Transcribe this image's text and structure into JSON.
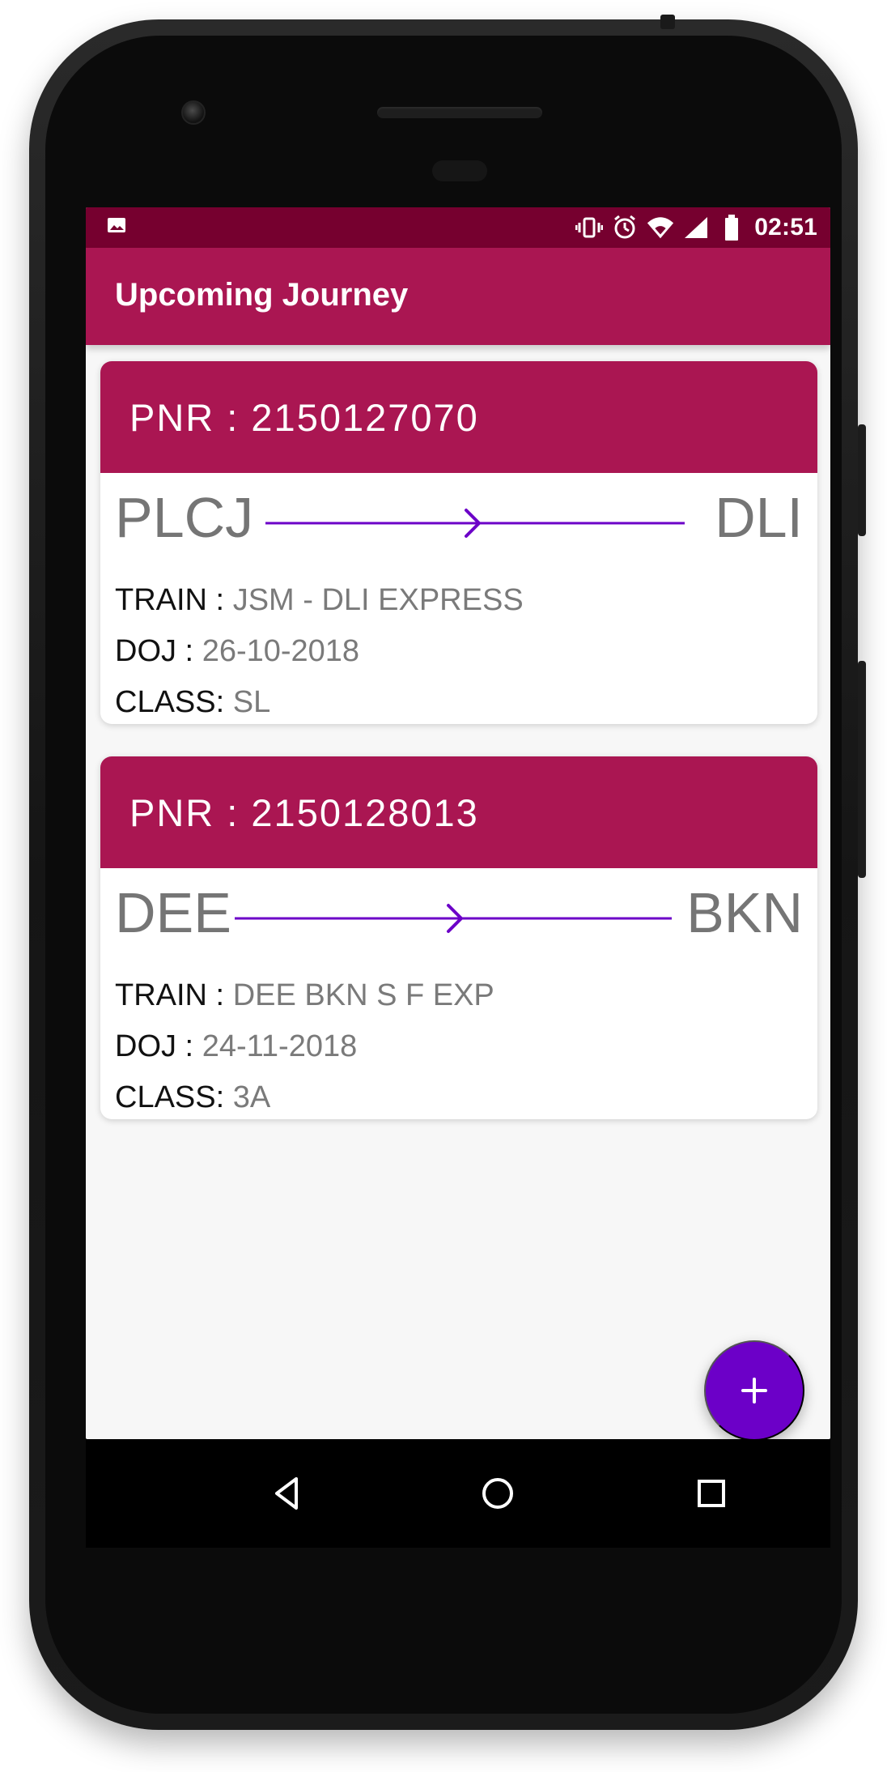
{
  "app": {
    "title": "Upcoming Journey"
  },
  "status_bar": {
    "time": "02:51",
    "icons": [
      "image-icon",
      "vibrate-icon",
      "alarm-icon",
      "wifi-icon",
      "signal-icon",
      "battery-icon"
    ]
  },
  "journeys": [
    {
      "pnr_label": "PNR :",
      "pnr": "2150127070",
      "from": "PLCJ",
      "to": "DLI",
      "train_label": "TRAIN :",
      "train": "JSM - DLI EXPRESS",
      "doj_label": "DOJ :",
      "doj": "26-10-2018",
      "class_label": "CLASS:",
      "class": "SL"
    },
    {
      "pnr_label": "PNR :",
      "pnr": "2150128013",
      "from": "DEE",
      "to": "BKN",
      "train_label": "TRAIN :",
      "train": "DEE BKN  S F EXP",
      "doj_label": "DOJ :",
      "doj": "24-11-2018",
      "class_label": "CLASS:",
      "class": "3A"
    }
  ],
  "fab": {
    "icon": "plus-icon"
  },
  "navigation": {
    "back_icon": "back-icon",
    "home_icon": "home-icon",
    "recent_icon": "recent-apps-icon"
  },
  "colors": {
    "status_bar": "#76002f",
    "primary": "#aa1652",
    "accent": "#6c00c8",
    "background": "#f7f7f7",
    "card": "#ffffff",
    "muted_text": "#757575"
  }
}
